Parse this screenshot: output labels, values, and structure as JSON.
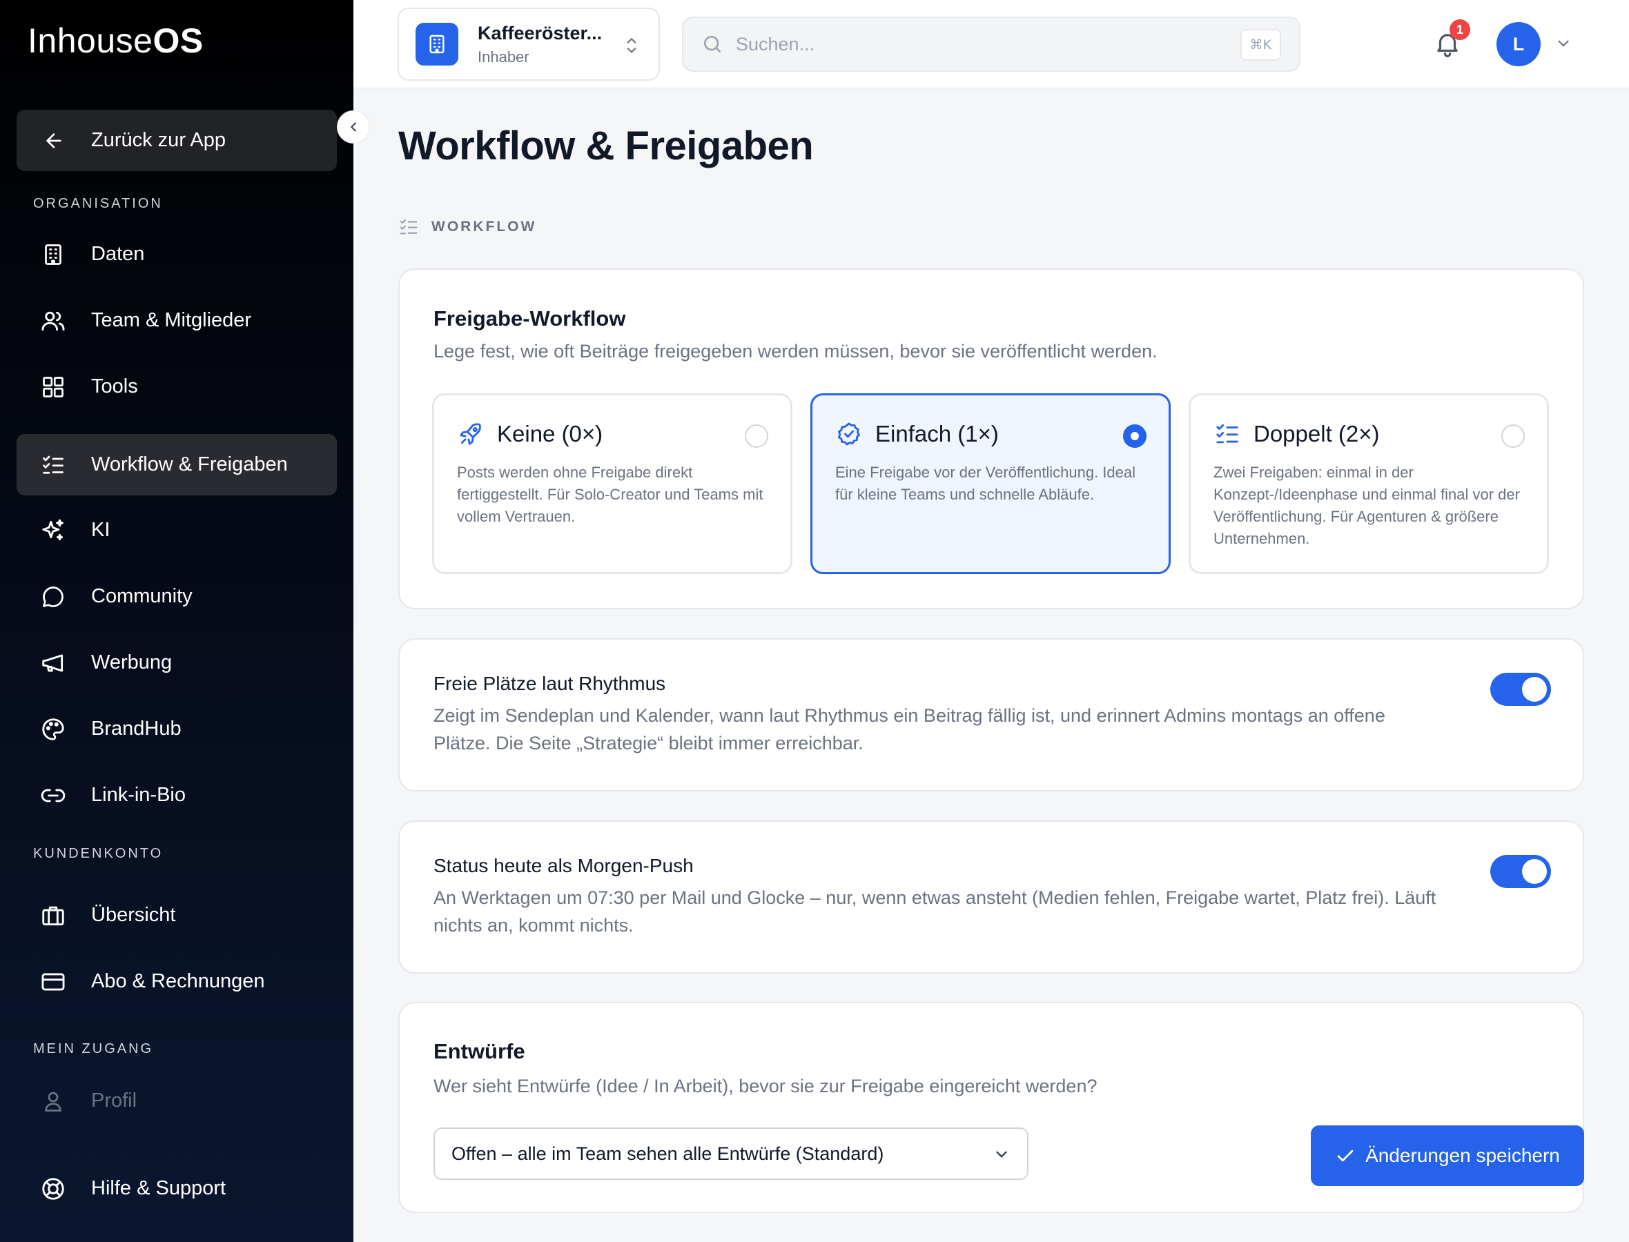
{
  "brand": {
    "logo_part1": "Inhouse",
    "logo_part2": "OS",
    "accent": "#2563eb"
  },
  "sidebar": {
    "back_label": "Zurück zur App",
    "sections": {
      "organisation": "ORGANISATION",
      "kundenkonto": "KUNDENKONTO",
      "mein_zugang": "MEIN ZUGANG"
    },
    "items": [
      {
        "label": "Daten",
        "icon": "building-icon"
      },
      {
        "label": "Team & Mitglieder",
        "icon": "users-icon"
      },
      {
        "label": "Tools",
        "icon": "grid-icon"
      },
      {
        "label": "Workflow & Freigaben",
        "icon": "checklist-icon",
        "active": true
      },
      {
        "label": "KI",
        "icon": "sparkles-icon"
      },
      {
        "label": "Community",
        "icon": "chat-bubble-icon"
      },
      {
        "label": "Werbung",
        "icon": "megaphone-icon"
      },
      {
        "label": "BrandHub",
        "icon": "palette-icon"
      },
      {
        "label": "Link-in-Bio",
        "icon": "link-icon"
      },
      {
        "label": "Übersicht",
        "icon": "briefcase-icon"
      },
      {
        "label": "Abo & Rechnungen",
        "icon": "credit-card-icon"
      },
      {
        "label": "Profil",
        "icon": "user-icon"
      },
      {
        "label": "Hilfe & Support",
        "icon": "lifebuoy-icon"
      }
    ]
  },
  "topbar": {
    "org_name": "Kaffeeröster...",
    "org_role": "Inhaber",
    "search_placeholder": "Suchen...",
    "search_shortcut": "⌘K",
    "notification_count": "1",
    "avatar_initial": "L"
  },
  "main": {
    "title": "Workflow & Freigaben",
    "section_label": "WORKFLOW",
    "approval": {
      "title": "Freigabe-Workflow",
      "description": "Lege fest, wie oft Beiträge freigegeben werden müssen, bevor sie veröffentlicht werden.",
      "options": [
        {
          "title": "Keine (0×)",
          "description": "Posts werden ohne Freigabe direkt fertiggestellt. Für Solo-Creator und Teams mit vollem Vertrauen.",
          "icon": "rocket-icon",
          "selected": false
        },
        {
          "title": "Einfach (1×)",
          "description": "Eine Freigabe vor der Veröffentlichung. Ideal für kleine Teams und schnelle Abläufe.",
          "icon": "badge-check-icon",
          "selected": true
        },
        {
          "title": "Doppelt (2×)",
          "description": "Zwei Freigaben: einmal in der Konzept-/Ideenphase und einmal final vor der Veröffentlichung. Für Agenturen & größere Unternehmen.",
          "icon": "checklist-icon",
          "selected": false
        }
      ]
    },
    "free_slots": {
      "title": "Freie Plätze laut Rhythmus",
      "description": "Zeigt im Sendeplan und Kalender, wann laut Rhythmus ein Beitrag fällig ist, und erinnert Admins montags an offene Plätze. Die Seite „Strategie“ bleibt immer erreichbar.",
      "enabled": true
    },
    "morning_push": {
      "title": "Status heute als Morgen-Push",
      "description": "An Werktagen um 07:30 per Mail und Glocke – nur, wenn etwas ansteht (Medien fehlen, Freigabe wartet, Platz frei). Läuft nichts an, kommt nichts.",
      "enabled": true
    },
    "drafts": {
      "title": "Entwürfe",
      "description": "Wer sieht Entwürfe (Idee / In Arbeit), bevor sie zur Freigabe eingereicht werden?",
      "selected_value": "Offen – alle im Team sehen alle Entwürfe (Standard)"
    },
    "save_label": "Änderungen speichern"
  }
}
